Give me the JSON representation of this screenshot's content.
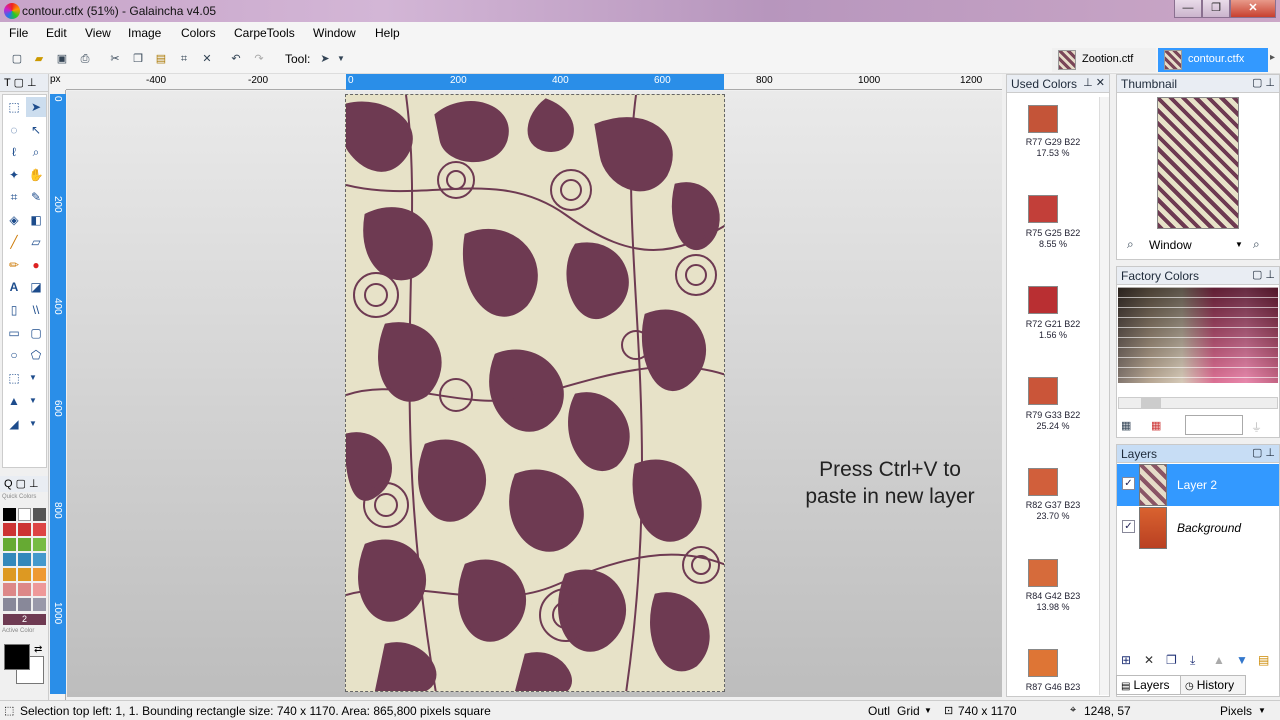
{
  "window": {
    "title": "contour.ctfx (51%) - Galaincha v4.05",
    "minimize": "—",
    "maximize": "❐",
    "close": "✕"
  },
  "menu": [
    "File",
    "Edit",
    "View",
    "Image",
    "Colors",
    "CarpeTools",
    "Window",
    "Help"
  ],
  "toolbar": {
    "tool_label": "Tool:"
  },
  "tabs": [
    {
      "label": "Zootion.ctf",
      "active": false
    },
    {
      "label": "contour.ctfx",
      "active": true
    }
  ],
  "ruler": {
    "unit": "px",
    "h_ticks": [
      "-400",
      "-200",
      "0",
      "200",
      "400",
      "600",
      "800",
      "1000",
      "1200"
    ],
    "v_ticks": [
      "0",
      "200",
      "400",
      "600",
      "800",
      "1000"
    ]
  },
  "left_dock": {
    "quick_colors": "Quick Colors",
    "active_color": "Active Color",
    "palette_index": "2"
  },
  "canvas": {
    "hint": "Press Ctrl+V to\npaste in new layer"
  },
  "used_colors": {
    "title": "Used Colors",
    "items": [
      {
        "hex": "#c45438",
        "label": "R77 G29 B22",
        "pct": "17.53 %"
      },
      {
        "hex": "#c23f39",
        "label": "R75 G25 B22",
        "pct": "8.55 %"
      },
      {
        "hex": "#b92f32",
        "label": "R72 G21 B22",
        "pct": "1.56 %"
      },
      {
        "hex": "#ca5539",
        "label": "R79 G33 B22",
        "pct": "25.24 %"
      },
      {
        "hex": "#d15f3b",
        "label": "R82 G37 B23",
        "pct": "23.70 %"
      },
      {
        "hex": "#d66b3b",
        "label": "R84 G42 B23",
        "pct": "13.98 %"
      },
      {
        "hex": "#de7535",
        "label": "R87 G46 B23",
        "pct": ""
      }
    ]
  },
  "thumbnail": {
    "title": "Thumbnail",
    "zoom_mode": "Window"
  },
  "factory_colors": {
    "title": "Factory Colors"
  },
  "layers": {
    "title": "Layers",
    "items": [
      {
        "name": "Layer 2",
        "selected": true
      },
      {
        "name": "Background",
        "selected": false
      }
    ],
    "tab_layers": "Layers",
    "tab_history": "History"
  },
  "status": {
    "selection": "Selection top left: 1, 1. Bounding rectangle size: 740 x 1170. Area: 865,800 pixels square",
    "outline": "Outl",
    "grid": "Grid",
    "size": "740 x 1170",
    "cursor": "1248, 57",
    "unit": "Pixels"
  },
  "colors": {
    "accent": "#3399ff",
    "ruler_selection": "#2a8ee8",
    "motif": "#6e3a52",
    "ground": "#e7e2c8"
  }
}
